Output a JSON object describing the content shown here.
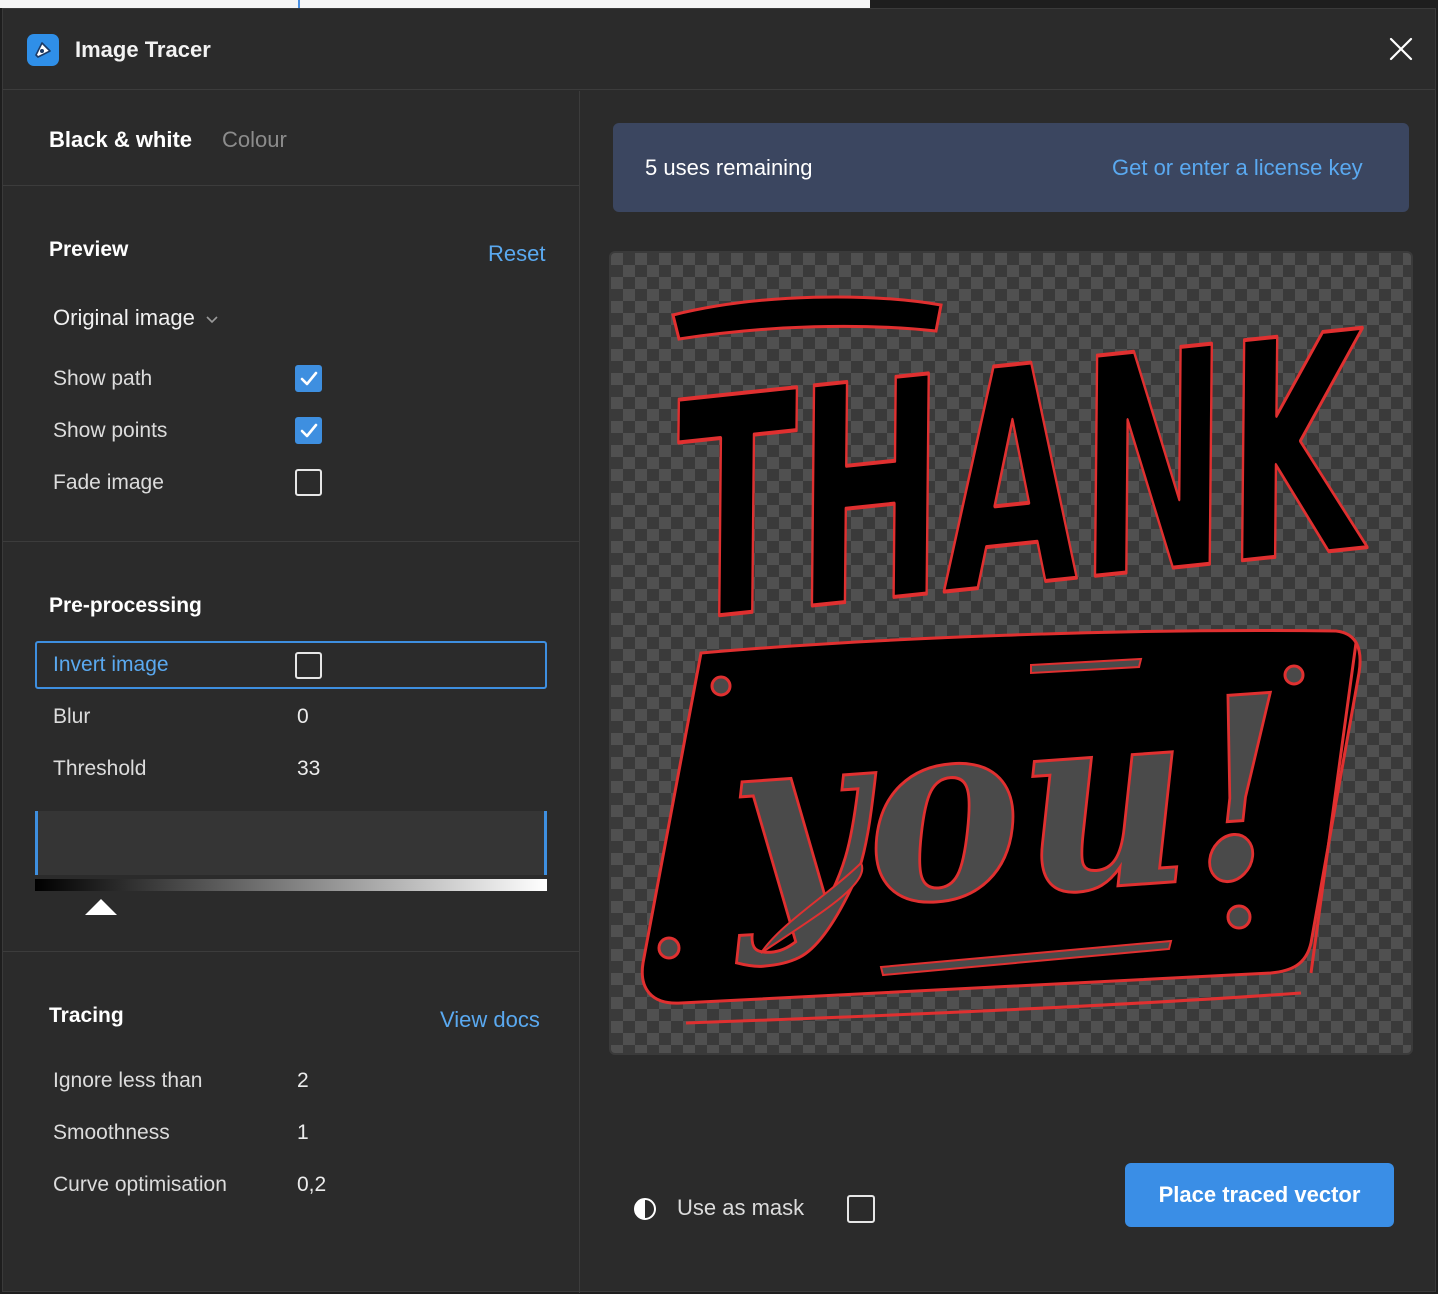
{
  "window": {
    "title": "Image Tracer",
    "icon": "image-tracer-icon",
    "close_icon": "close-icon"
  },
  "tabs": {
    "active": "Black & white",
    "inactive": "Colour"
  },
  "preview": {
    "title": "Preview",
    "reset": "Reset",
    "dropdown_value": "Original image",
    "show_path_label": "Show path",
    "show_path_checked": true,
    "show_points_label": "Show points",
    "show_points_checked": true,
    "fade_image_label": "Fade image",
    "fade_image_checked": false
  },
  "preprocessing": {
    "title": "Pre-processing",
    "invert_label": "Invert image",
    "invert_checked": false,
    "blur_label": "Blur",
    "blur_value": "0",
    "threshold_label": "Threshold",
    "threshold_value": "33"
  },
  "tracing": {
    "title": "Tracing",
    "docs_link": "View docs",
    "ignore_label": "Ignore less than",
    "ignore_value": "2",
    "smoothness_label": "Smoothness",
    "smoothness_value": "1",
    "curve_label": "Curve optimisation",
    "curve_value": "0,2"
  },
  "license": {
    "uses_text": "5 uses remaining",
    "link_text": "Get or enter a license key"
  },
  "canvas": {
    "line1": "THANK",
    "line2": "you!",
    "path_color": "#e03030"
  },
  "footer": {
    "mask_label": "Use as mask",
    "mask_checked": false,
    "mask_icon": "contrast-icon",
    "place_button": "Place traced vector"
  },
  "colors": {
    "accent": "#3e8fe0",
    "link": "#5aa9f0",
    "banner": "#3b4660",
    "background": "#2b2b2b"
  }
}
